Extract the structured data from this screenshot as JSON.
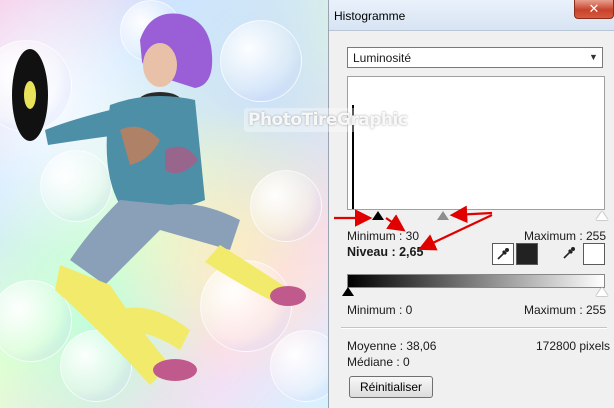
{
  "window": {
    "title": "Histogramme",
    "close_glyph": "✕"
  },
  "watermark": "PhotoTireGraphic",
  "channel": {
    "selected": "Luminosité"
  },
  "input_levels": {
    "min_label": "Minimum : 30",
    "max_label": "Maximum : 255",
    "gamma_label": "Niveau : 2,65",
    "black_point": 30,
    "white_point": 255,
    "gamma": 2.65
  },
  "output_levels": {
    "min_label": "Minimum : 0",
    "max_label": "Maximum : 255",
    "black_point": 0,
    "white_point": 255
  },
  "stats": {
    "mean_label": "Moyenne : 38,06",
    "median_label": "Médiane : 0",
    "pixels_label": "172800 pixels"
  },
  "buttons": {
    "reset_label": "Réinitialiser"
  },
  "icons": {
    "close": "close-icon",
    "dropdown": "chevron-down-icon",
    "eyedropper": "eyedropper-icon"
  },
  "colors": {
    "annotation_arrow": "#e00000",
    "close_button": "#c7432b",
    "panel_bg": "#f0f0f0"
  }
}
